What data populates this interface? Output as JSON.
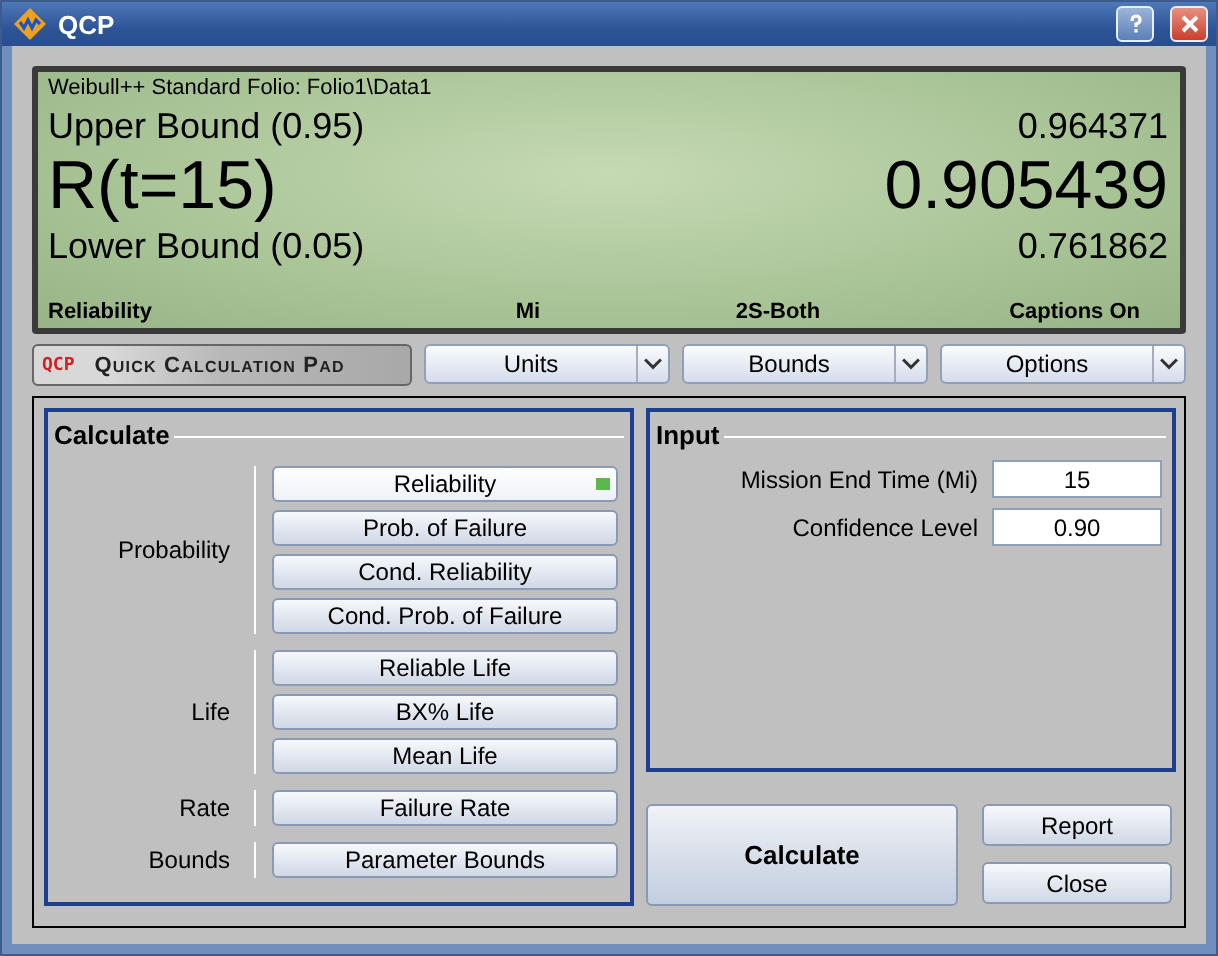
{
  "window": {
    "title": "QCP"
  },
  "display": {
    "source": "Weibull++ Standard Folio: Folio1\\Data1",
    "upper_label": "Upper Bound (0.95)",
    "upper_value": "0.964371",
    "main_label": "R(t=15)",
    "main_value": "0.905439",
    "lower_label": "Lower Bound (0.05)",
    "lower_value": "0.761862",
    "status": [
      "Reliability",
      "Mi",
      "2S-Both",
      "Captions On"
    ]
  },
  "toolbar": {
    "logo": "QCP",
    "title": "Quick Calculation Pad",
    "menus": [
      "Units",
      "Bounds",
      "Options"
    ]
  },
  "calculate": {
    "title": "Calculate",
    "groups": [
      {
        "label": "Probability",
        "buttons": [
          {
            "label": "Reliability",
            "selected": true
          },
          {
            "label": "Prob. of Failure",
            "selected": false
          },
          {
            "label": "Cond. Reliability",
            "selected": false
          },
          {
            "label": "Cond. Prob. of Failure",
            "selected": false
          }
        ]
      },
      {
        "label": "Life",
        "buttons": [
          {
            "label": "Reliable Life",
            "selected": false
          },
          {
            "label": "BX% Life",
            "selected": false
          },
          {
            "label": "Mean Life",
            "selected": false
          }
        ]
      },
      {
        "label": "Rate",
        "buttons": [
          {
            "label": "Failure Rate",
            "selected": false
          }
        ]
      },
      {
        "label": "Bounds",
        "buttons": [
          {
            "label": "Parameter Bounds",
            "selected": false
          }
        ]
      }
    ]
  },
  "input": {
    "title": "Input",
    "fields": [
      {
        "label": "Mission End Time (Mi)",
        "value": "15"
      },
      {
        "label": "Confidence Level",
        "value": "0.90"
      }
    ]
  },
  "actions": {
    "primary": "Calculate",
    "secondary": [
      "Report",
      "Close"
    ]
  }
}
